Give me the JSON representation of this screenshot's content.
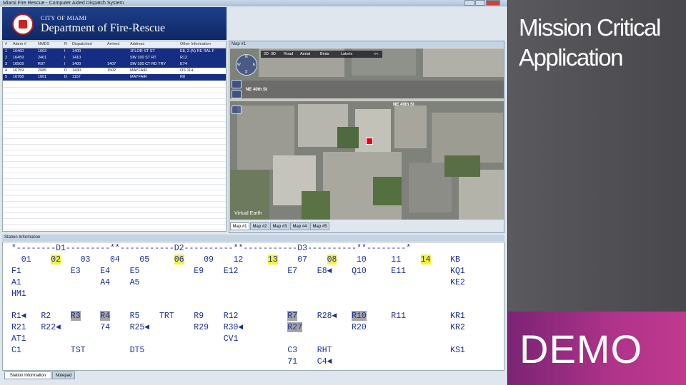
{
  "window": {
    "title": "Miami Fire Rescue - Computer Aided Dispatch System"
  },
  "header": {
    "city": "CITY OF MIAMI",
    "department": "Department of Fire-Rescue"
  },
  "alarms": {
    "columns": [
      "#",
      "Alarm #",
      "NMDS",
      "R",
      "Dispatched",
      "Arrived",
      "Address",
      "Other Information"
    ],
    "rows": [
      {
        "sel": true,
        "cells": [
          "1",
          "16460",
          "1003",
          "I",
          "1400",
          "",
          "1FLOR ST ST",
          "E8, 2 (N) RE RAL F"
        ]
      },
      {
        "sel": true,
        "cells": [
          "2",
          "16459",
          "2401",
          "I",
          "1410",
          "",
          "SW 100 ST RT",
          "R12"
        ]
      },
      {
        "sel": true,
        "cells": [
          "3",
          "16509",
          "R07",
          "I",
          "1400",
          "1407",
          "SW 100 CT RD TRY",
          "E74"
        ]
      },
      {
        "sel": false,
        "cells": [
          "4",
          "16759",
          "2085",
          "D",
          "1430",
          "1502",
          "MAYFAIR",
          "OS 114"
        ]
      },
      {
        "sel": true,
        "cells": [
          "5",
          "16768",
          "1001",
          "D",
          "1157",
          "",
          "MAYFAIR",
          "R8"
        ]
      }
    ]
  },
  "map": {
    "header": "Map #1",
    "toolbar": [
      "2D",
      "3D",
      "Road",
      "Aerial",
      "Birds",
      "Labels"
    ],
    "toolbar_collapse": "<<",
    "compass": {
      "n": "N",
      "s": "S",
      "e": "E",
      "w": "W"
    },
    "streets": [
      "NE 40th St",
      "NE 40th St"
    ],
    "watermark": "Virtual Earth",
    "tabs": [
      "Map #1",
      "Map #2",
      "Map #3",
      "Map #4",
      "Map #5"
    ]
  },
  "station": {
    "header": "Station Information",
    "divider": "*--------D1---------**-----------D2----------**-----------D3----------**--------*",
    "numbers": [
      "01",
      "02",
      "03",
      "04",
      "05",
      "06",
      "09",
      "12",
      "13",
      "07",
      "08",
      "10",
      "11",
      "14",
      "KB"
    ],
    "rows": [
      [
        "F1",
        "E3",
        "E4",
        "E5",
        "E9",
        "E12",
        "E7",
        "E8◄",
        "Q10",
        "E11",
        "KQ1"
      ],
      [
        "A1",
        "A4",
        "A5",
        "KE2"
      ],
      [
        "HM1"
      ],
      [
        "R1◄",
        "R2",
        "R3",
        "R4",
        "R5",
        "TRT",
        "R9",
        "R12",
        "R7",
        "R28◄",
        "R10",
        "R11",
        "KR1"
      ],
      [
        "R21",
        "R22◄",
        "74",
        "R25◄",
        "R29",
        "R30◄",
        "R27",
        "R20",
        "KR2"
      ],
      [
        "AT1",
        "CV1"
      ],
      [
        "C1",
        "TST",
        "DT5",
        "C3",
        "RHT",
        "KS1"
      ],
      [
        "71",
        "C4◄"
      ]
    ]
  },
  "bottom_tabs": [
    "Station Information",
    "Notepad"
  ],
  "slide": {
    "title": "Mission Critical Application",
    "demo": "DEMO"
  },
  "colors": {
    "header_navy": "#1e3f8a",
    "selected_row": "#152d82",
    "highlight_yellow": "#f4f23a",
    "demo_magenta": "#b0338a"
  }
}
